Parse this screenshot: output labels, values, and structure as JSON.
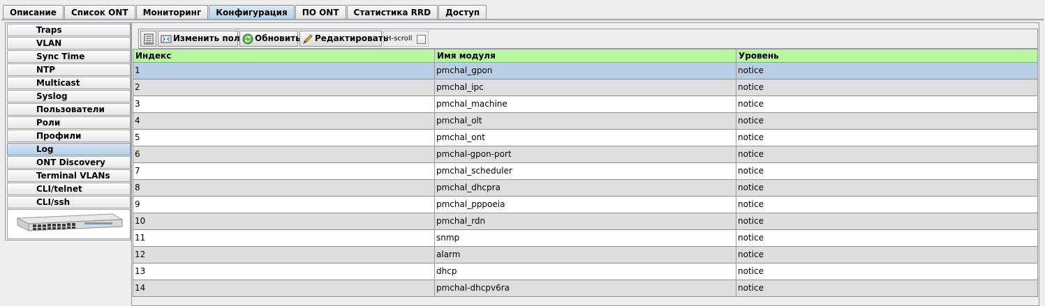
{
  "tabs": [
    {
      "label": "Описание",
      "active": false
    },
    {
      "label": "Список ONT",
      "active": false
    },
    {
      "label": "Мониторинг",
      "active": false
    },
    {
      "label": "Конфигурация",
      "active": true
    },
    {
      "label": "ПО ONT",
      "active": false
    },
    {
      "label": "Статистика RRD",
      "active": false
    },
    {
      "label": "Доступ",
      "active": false
    }
  ],
  "sidebar": {
    "items": [
      {
        "label": "Traps"
      },
      {
        "label": "VLAN"
      },
      {
        "label": "Sync Time"
      },
      {
        "label": "NTP"
      },
      {
        "label": "Multicast"
      },
      {
        "label": "Syslog"
      },
      {
        "label": "Пользователи"
      },
      {
        "label": "Роли"
      },
      {
        "label": "Профили"
      },
      {
        "label": "Log",
        "active": true
      },
      {
        "label": "ONT Discovery"
      },
      {
        "label": "Terminal VLANs"
      },
      {
        "label": "CLI/telnet"
      },
      {
        "label": "CLI/ssh"
      }
    ]
  },
  "toolbar": {
    "edit_fields_label": "Изменить поля",
    "refresh_label": "Обновить",
    "edit_label": "Редактировать",
    "hscroll_label": "H-scroll"
  },
  "table": {
    "headers": [
      "Индекс",
      "Имя модуля",
      "Уровень"
    ],
    "selected_row": 0,
    "rows": [
      [
        "1",
        "pmchal_gpon",
        "notice"
      ],
      [
        "2",
        "pmchal_ipc",
        "notice"
      ],
      [
        "3",
        "pmchal_machine",
        "notice"
      ],
      [
        "4",
        "pmchal_olt",
        "notice"
      ],
      [
        "5",
        "pmchal_ont",
        "notice"
      ],
      [
        "6",
        "pmchal-gpon-port",
        "notice"
      ],
      [
        "7",
        "pmchal_scheduler",
        "notice"
      ],
      [
        "8",
        "pmchal_dhcpra",
        "notice"
      ],
      [
        "9",
        "pmchal_pppoeia",
        "notice"
      ],
      [
        "10",
        "pmchal_rdn",
        "notice"
      ],
      [
        "11",
        "snmp",
        "notice"
      ],
      [
        "12",
        "alarm",
        "notice"
      ],
      [
        "13",
        "dhcp",
        "notice"
      ],
      [
        "14",
        "pmchal-dhcpv6ra",
        "notice"
      ]
    ]
  },
  "colors": {
    "header_green": "#b7f7a2",
    "selection_blue": "#b8cfe5",
    "row_gray": "#dedede"
  }
}
